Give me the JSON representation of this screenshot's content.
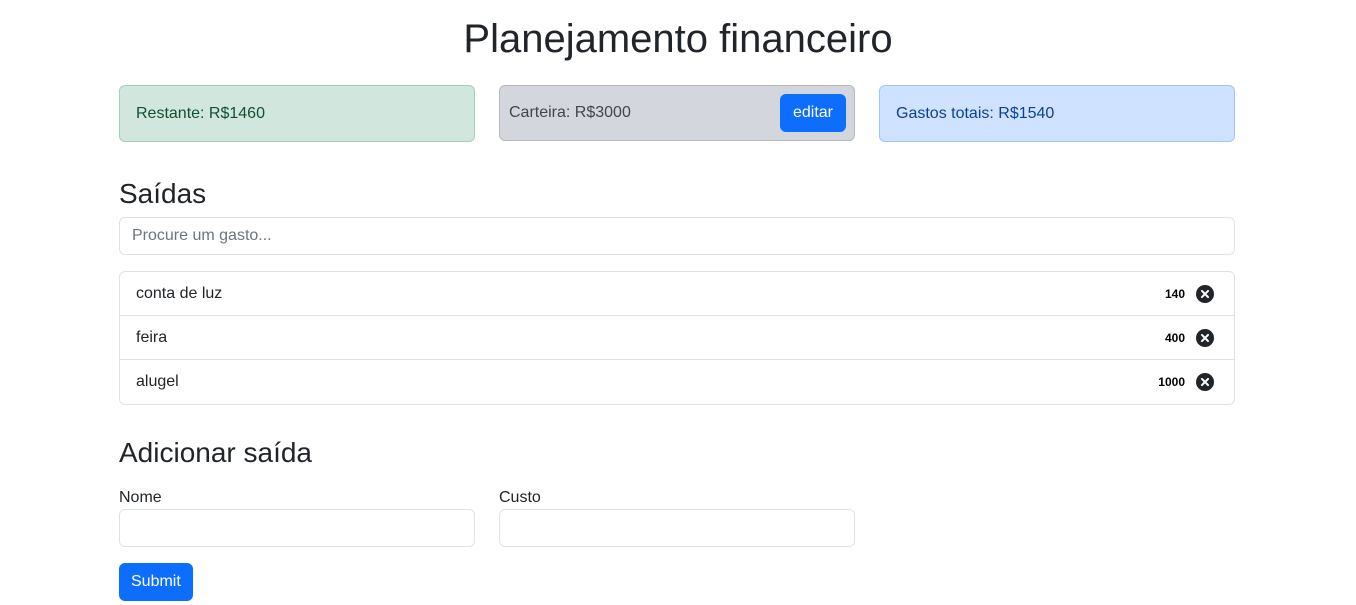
{
  "header": {
    "title": "Planejamento financeiro"
  },
  "summary": {
    "remaining": "Restante: R$1460",
    "wallet": "Carteira: R$3000",
    "edit_label": "editar",
    "total_spent": "Gastos totais: R$1540"
  },
  "expenses": {
    "heading": "Saídas",
    "search_placeholder": "Procure um gasto...",
    "items": [
      {
        "name": "conta de luz",
        "cost": "140"
      },
      {
        "name": "feira",
        "cost": "400"
      },
      {
        "name": "alugel",
        "cost": "1000"
      }
    ],
    "delete_icon": "x-circle-fill-icon"
  },
  "add_form": {
    "heading": "Adicionar saída",
    "name_label": "Nome",
    "cost_label": "Custo",
    "name_value": "",
    "cost_value": "",
    "submit_label": "Submit"
  },
  "colors": {
    "primary": "#0d6efd",
    "success_bg": "#d1e7dd",
    "secondary_bg": "#d3d6dc",
    "primary_bg": "#cfe2ff"
  }
}
